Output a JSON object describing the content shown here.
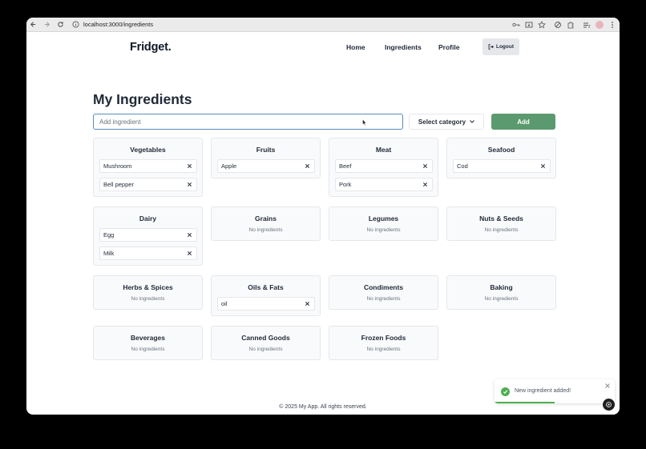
{
  "browser": {
    "url": "localhost:3000/ingredients"
  },
  "header": {
    "logo": "Fridget.",
    "nav": [
      "Home",
      "Ingredients",
      "Profile"
    ],
    "logout_label": "Logout"
  },
  "page": {
    "title": "My Ingredients",
    "input_placeholder": "Add ingredient",
    "input_value": "",
    "select_label": "Select category",
    "add_label": "Add",
    "empty_text": "No ingredients"
  },
  "categories": [
    {
      "name": "Vegetables",
      "items": [
        "Mushroom",
        "Bell pepper"
      ]
    },
    {
      "name": "Fruits",
      "items": [
        "Apple"
      ]
    },
    {
      "name": "Meat",
      "items": [
        "Beef",
        "Pork"
      ]
    },
    {
      "name": "Seafood",
      "items": [
        "Cod"
      ]
    },
    {
      "name": "Dairy",
      "items": [
        "Egg",
        "Milk"
      ]
    },
    {
      "name": "Grains",
      "items": []
    },
    {
      "name": "Legumes",
      "items": []
    },
    {
      "name": "Nuts & Seeds",
      "items": []
    },
    {
      "name": "Herbs & Spices",
      "items": []
    },
    {
      "name": "Oils & Fats",
      "items": [
        "oil"
      ]
    },
    {
      "name": "Condiments",
      "items": []
    },
    {
      "name": "Baking",
      "items": []
    },
    {
      "name": "Beverages",
      "items": []
    },
    {
      "name": "Canned Goods",
      "items": []
    },
    {
      "name": "Frozen Foods",
      "items": []
    }
  ],
  "footer": "© 2025 My App. All rights reserved.",
  "toast": {
    "message": "New ingredient added!",
    "progress": 0.5
  },
  "colors": {
    "accent": "#5b9a6e",
    "success": "#4caf50",
    "input_border": "#5b8db8"
  }
}
